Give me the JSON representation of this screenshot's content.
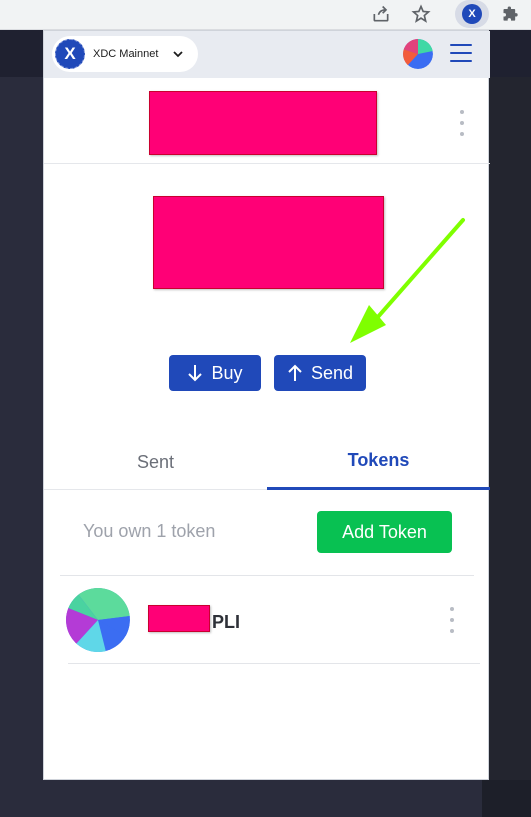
{
  "browser": {
    "share_icon": "share-icon",
    "star_icon": "bookmark-star-icon",
    "extension_icon": "xdc-extension-icon",
    "extension_letter": "X",
    "puzzle_icon": "extensions-puzzle-icon"
  },
  "header": {
    "network_logo_letter": "X",
    "network_name": "XDC Mainnet",
    "chevron_icon": "chevron-down-icon",
    "avatar_icon": "account-avatar-icon",
    "menu_icon": "hamburger-menu-icon"
  },
  "account": {
    "name_redacted": true,
    "options_icon": "kebab-menu-icon"
  },
  "balance": {
    "amount_redacted": true
  },
  "actions": {
    "buy_label": "Buy",
    "send_label": "Send",
    "buy_icon": "arrow-down-icon",
    "send_icon": "arrow-up-icon"
  },
  "tabs": {
    "sent_label": "Sent",
    "tokens_label": "Tokens",
    "active": "Tokens"
  },
  "tokens": {
    "own_count_text": "You own 1 token",
    "add_token_label": "Add Token",
    "list": [
      {
        "symbol": "PLI",
        "balance_redacted": true,
        "logo_icon": "token-logo-icon",
        "options_icon": "kebab-menu-icon"
      }
    ]
  },
  "annotation": {
    "arrow_color": "#7fff00",
    "arrow_icon": "annotation-arrow-icon"
  },
  "colors": {
    "primary": "#2049b9",
    "success": "#08c152",
    "redaction": "#ff0076"
  }
}
